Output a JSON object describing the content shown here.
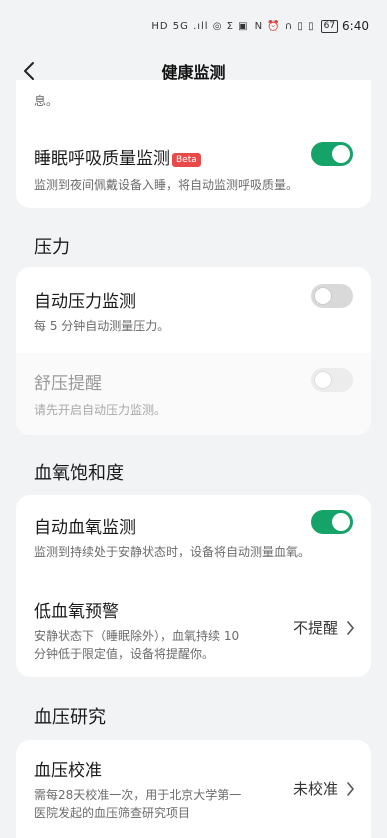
{
  "status_bar": {
    "icons_left": "HD 5G .ıll ◎ Σ ▣",
    "icons_right": "N ⏰ ∩ ▯ ▯",
    "battery": "67",
    "time": "6:40"
  },
  "header": {
    "title": "健康监测",
    "back_icon": "chevron-left-icon"
  },
  "top_card": {
    "partial_text": "息。",
    "sleep_breath": {
      "title": "睡眠呼吸质量监测",
      "badge": "Beta",
      "description": "监测到夜间佩戴设备入睡，将自动监测呼吸质量。",
      "enabled": true
    }
  },
  "stress": {
    "section_title": "压力",
    "auto_stress": {
      "title": "自动压力监测",
      "description": "每 5 分钟自动测量压力。",
      "enabled": false
    },
    "relax_reminder": {
      "title": "舒压提醒",
      "description": "请先开启自动压力监测。",
      "enabled": false,
      "disabled": true
    }
  },
  "spo2": {
    "section_title": "血氧饱和度",
    "auto_spo2": {
      "title": "自动血氧监测",
      "description": "监测到持续处于安静状态时，设备将自动测量血氧。",
      "enabled": true
    },
    "low_spo2_alert": {
      "title": "低血氧预警",
      "description_line1": "安静状态下（睡眠除外），血氧持续 10",
      "description_line2": "分钟低于限定值，设备将提醒你。",
      "value": "不提醒"
    }
  },
  "blood_pressure": {
    "section_title": "血压研究",
    "calibration": {
      "title": "血压校准",
      "description_line1": "需每28天校准一次，用于北京大学第一",
      "description_line2": "医院发起的血压筛查研究项目",
      "value": "未校准"
    }
  },
  "colors": {
    "background": "#f1f3f5",
    "card": "#ffffff",
    "toggle_on": "#15a36a",
    "toggle_off": "#d9d9d9",
    "beta_badge": "#e84a4a"
  }
}
